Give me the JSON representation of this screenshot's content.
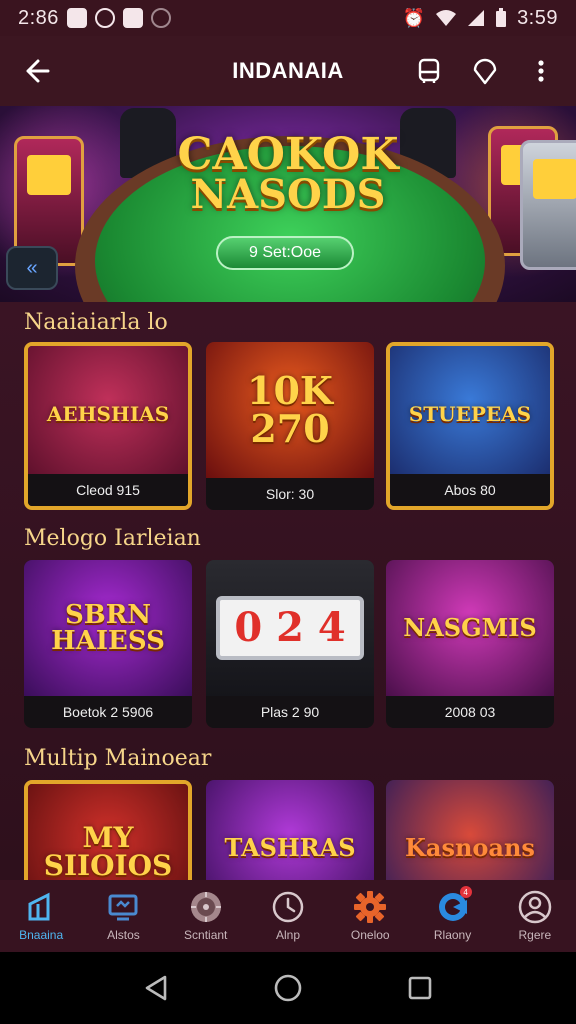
{
  "status_bar": {
    "time_left": "2:86",
    "time_right": "3:59",
    "left_icons": [
      "notification-icon",
      "record-icon",
      "notification-icon",
      "cast-icon"
    ],
    "right_icons": [
      "alarm-icon",
      "wifi-icon",
      "signal-icon",
      "battery-icon"
    ]
  },
  "app_bar": {
    "title": "INDANAIA"
  },
  "hero": {
    "logo_line1": "CAOKOK",
    "logo_line2": "NASODS",
    "cta_label": "9 Set:Ooe",
    "side_button_glyph": "«"
  },
  "sections": [
    {
      "title": "Naaiaiarla lo",
      "cards": [
        {
          "art_text": "AEHSHIAS",
          "label": "Cleod 915"
        },
        {
          "art_text": "10K 270",
          "label": "Slor: 30"
        },
        {
          "art_text": "STUEPEAS",
          "label": "Abos 80"
        }
      ]
    },
    {
      "title": "Melogo Iarleian",
      "cards": [
        {
          "art_text": "SBRN HAIESS",
          "label": "Boetok 2 5906"
        },
        {
          "art_text": "0 2 4",
          "label": "Plas 2 90"
        },
        {
          "art_text": "NASGMIS",
          "label": "2008 03"
        }
      ]
    },
    {
      "title": "Multip Mainoear",
      "cards": [
        {
          "art_text": "MY SIIOIOS",
          "label": ""
        },
        {
          "art_text": "TASHRAS",
          "label": ""
        },
        {
          "art_text": "Kasnoans",
          "label": ""
        }
      ]
    }
  ],
  "bottom_nav": [
    {
      "label": "Bnaaina",
      "icon": "home-icon",
      "active": true
    },
    {
      "label": "Alstos",
      "icon": "monitor-icon",
      "active": false
    },
    {
      "label": "Scntiant",
      "icon": "roulette-icon",
      "active": false
    },
    {
      "label": "Alnp",
      "icon": "clock-icon",
      "active": false
    },
    {
      "label": "Oneloo",
      "icon": "gear-icon",
      "active": false
    },
    {
      "label": "Rlaony",
      "icon": "message-icon",
      "active": false,
      "badge": "4"
    },
    {
      "label": "Rgere",
      "icon": "profile-icon",
      "active": false
    }
  ],
  "colors": {
    "app_bar_bg": "#3c1621",
    "section_title": "#f6d58a",
    "active_nav": "#4fb6f0",
    "cta_green": "#1c8a36"
  }
}
